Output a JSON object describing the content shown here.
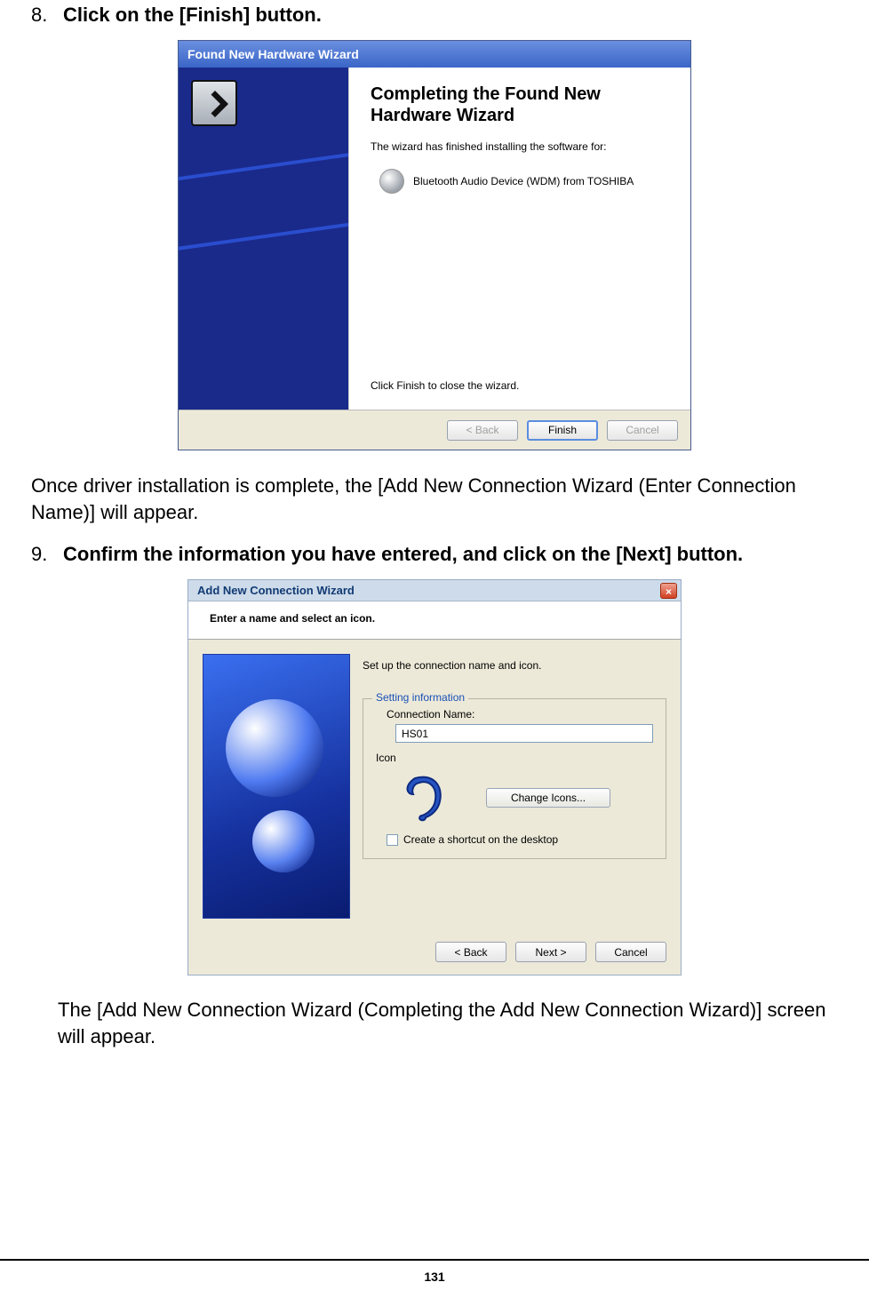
{
  "step8": {
    "num": "8.",
    "text": "Click on the [Finish] button."
  },
  "wiz1": {
    "title": "Found New Hardware Wizard",
    "heading": "Completing the Found New Hardware Wizard",
    "sub": "The wizard has finished installing the software for:",
    "device": "Bluetooth Audio Device (WDM) from TOSHIBA",
    "closeText": "Click Finish to close the wizard.",
    "buttons": {
      "back": "< Back",
      "finish": "Finish",
      "cancel": "Cancel"
    }
  },
  "para1": "Once driver installation is complete, the [Add New Connection Wizard (Enter Connection Name)] will appear.",
  "step9": {
    "num": "9.",
    "text": "Confirm the information you have entered, and click on the [Next] button."
  },
  "wiz2": {
    "title": "Add New Connection Wizard",
    "header": "Enter a name and select an icon.",
    "instr": "Set up the connection name and icon.",
    "legend": "Setting information",
    "connLabel": "Connection Name:",
    "connValue": "HS01",
    "iconLabel": "Icon",
    "changeBtn": "Change Icons...",
    "shortcut": "Create a shortcut on the desktop",
    "buttons": {
      "back": "< Back",
      "next": "Next >",
      "cancel": "Cancel"
    }
  },
  "para2": "The [Add New Connection Wizard (Completing the Add New Connection Wizard)] screen will appear.",
  "pageNum": "131"
}
